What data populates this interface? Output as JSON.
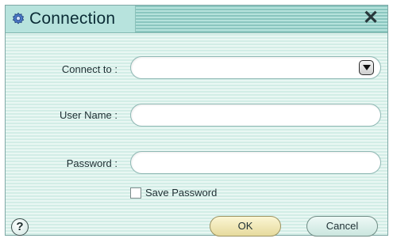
{
  "window": {
    "title": "Connection",
    "icon": "gear-icon",
    "close_label": "✕"
  },
  "form": {
    "connect_to": {
      "label": "Connect to :",
      "value": "",
      "icon": "dropdown-arrow-icon"
    },
    "user_name": {
      "label": "User Name :",
      "value": ""
    },
    "password": {
      "label": "Password :",
      "value": ""
    },
    "save_password": {
      "label": "Save Password",
      "checked": false
    }
  },
  "footer": {
    "help_label": "?",
    "ok_label": "OK",
    "cancel_label": "Cancel"
  },
  "colors": {
    "dialog_stripe_light": "#e9f7f3",
    "dialog_stripe_dark": "#d2ede6",
    "ok_button": "#e6da9d",
    "cancel_button": "#cbe6df"
  }
}
